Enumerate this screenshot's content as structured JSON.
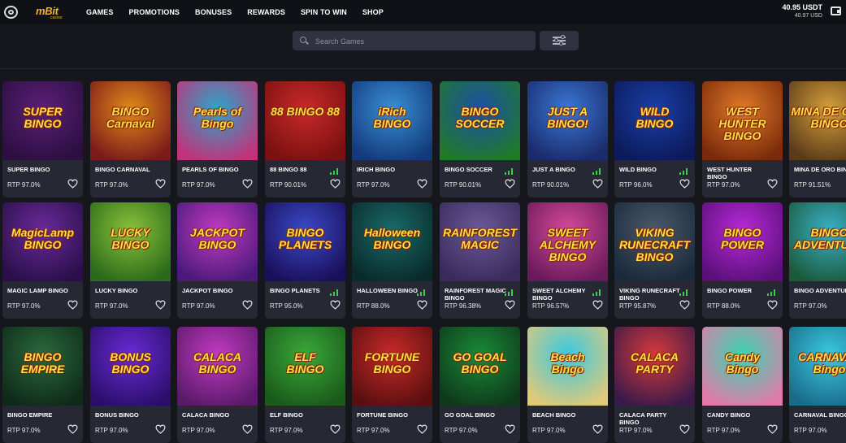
{
  "brand": {
    "name": "mBit",
    "sub": "casino"
  },
  "nav": [
    "GAMES",
    "PROMOTIONS",
    "BONUSES",
    "REWARDS",
    "SPIN TO WIN",
    "SHOP"
  ],
  "balance": {
    "main": "40.95 USDT",
    "sub": "40.97 USD"
  },
  "search": {
    "placeholder": "Search Games"
  },
  "colors": {
    "accent": "#f0b323",
    "bg": "#16171d",
    "card": "#262833",
    "signal": "#3ecf4a"
  },
  "games": [
    {
      "title": "SUPER BINGO",
      "rtp": "RTP 97.0%",
      "art": "SUPER\nBINGO",
      "bg": "#5a1f78,#2c0f40",
      "signal": false
    },
    {
      "title": "BINGO CARNAVAL",
      "rtp": "RTP 97.0%",
      "art": "BINGO\nCarnaval",
      "bg": "#e08a1a,#7a1a1a",
      "signal": false
    },
    {
      "title": "PEARLS OF BINGO",
      "rtp": "RTP 97.0%",
      "art": "Pearls of\nBingo",
      "bg": "#2aa6c9,#c2327a",
      "signal": false
    },
    {
      "title": "88 BINGO 88",
      "rtp": "RTP 90.01%",
      "art": "88 BINGO 88",
      "bg": "#c92a2a,#7a1010",
      "signal": true
    },
    {
      "title": "IRICH BINGO",
      "rtp": "RTP 97.0%",
      "art": "iRich\nBINGO",
      "bg": "#3a8fd6,#123a7a",
      "signal": false
    },
    {
      "title": "BINGO SOCCER",
      "rtp": "RTP 90.01%",
      "art": "BINGO SOCCER",
      "bg": "#1d4fa8,#1f7a2a",
      "signal": true
    },
    {
      "title": "JUST A BINGO",
      "rtp": "RTP 90.01%",
      "art": "JUST A BINGO!",
      "bg": "#3a78d6,#1a2a6a",
      "signal": true
    },
    {
      "title": "WILD BINGO",
      "rtp": "RTP 96.0%",
      "art": "WILD\nBINGO",
      "bg": "#1a3fa8,#0c1a5a",
      "signal": true
    },
    {
      "title": "WEST HUNTER BINGO",
      "rtp": "RTP 97.0%",
      "art": "WEST HUNTER\nBINGO",
      "bg": "#e07a2a,#7a2a0a",
      "signal": false
    },
    {
      "title": "MINA DE ORO BINGO",
      "rtp": "RTP 91.51%",
      "art": "MINA DE ORO\nBINGO",
      "bg": "#d6a03a,#5a3a1a",
      "signal": true
    },
    {
      "title": "MAGIC LAMP BINGO",
      "rtp": "RTP 97.0%",
      "art": "MagicLamp\nBINGO",
      "bg": "#6a2a9a,#2a0f4a",
      "signal": false
    },
    {
      "title": "LUCKY BINGO",
      "rtp": "RTP 97.0%",
      "art": "LUCKY\nBINGO",
      "bg": "#8ac23a,#2a6a1a",
      "signal": false
    },
    {
      "title": "JACKPOT BINGO",
      "rtp": "RTP 97.0%",
      "art": "JACKPOT\nBINGO",
      "bg": "#c23ac2,#4a1a7a",
      "signal": false
    },
    {
      "title": "BINGO PLANETS",
      "rtp": "RTP 95.0%",
      "art": "BINGO\nPLANETS",
      "bg": "#3a4ac9,#1a0f5a",
      "signal": true
    },
    {
      "title": "HALLOWEEN BINGO",
      "rtp": "RTP 88.0%",
      "art": "Halloween\nBINGO",
      "bg": "#1a6a6a,#0a2a2a",
      "signal": true
    },
    {
      "title": "RAINFOREST MAGIC BINGO",
      "rtp": "RTP 96.38%",
      "art": "RAINFOREST\nMAGIC",
      "bg": "#6a5a9a,#3a2a5a",
      "signal": true
    },
    {
      "title": "SWEET ALCHEMY BINGO",
      "rtp": "RTP 96.57%",
      "art": "SWEET\nALCHEMY\nBINGO",
      "bg": "#d64a9a,#6a1a5a",
      "signal": true
    },
    {
      "title": "VIKING RUNECRAFT BINGO",
      "rtp": "RTP 95.87%",
      "art": "VIKING\nRUNECRAFT\nBINGO",
      "bg": "#4a5a6a,#1a2a3a",
      "signal": true
    },
    {
      "title": "BINGO POWER",
      "rtp": "RTP 88.0%",
      "art": "BINGO\nPOWER",
      "bg": "#b82ad6,#5a0f7a",
      "signal": true
    },
    {
      "title": "BINGO ADVENTURE",
      "rtp": "RTP 97.0%",
      "art": "BINGO\nADVENTURE",
      "bg": "#3ab0c9,#1a5a3a",
      "signal": false
    },
    {
      "title": "BINGO EMPIRE",
      "rtp": "RTP 97.0%",
      "art": "BINGO\nEMPIRE",
      "bg": "#2a6a3a,#0f2a1a",
      "signal": false
    },
    {
      "title": "BONUS BINGO",
      "rtp": "RTP 97.0%",
      "art": "BONUS\nBINGO",
      "bg": "#6a2ad6,#2a0f6a",
      "signal": false
    },
    {
      "title": "CALACA BINGO",
      "rtp": "RTP 97.0%",
      "art": "CALACA\nBINGO",
      "bg": "#c23ac2,#5a1a6a",
      "signal": false
    },
    {
      "title": "ELF BINGO",
      "rtp": "RTP 97.0%",
      "art": "ELF\nBINGO",
      "bg": "#3aa83a,#1a5a1a",
      "signal": false
    },
    {
      "title": "FORTUNE BINGO",
      "rtp": "RTP 97.0%",
      "art": "FORTUNE\nBINGO",
      "bg": "#c92a2a,#5a0f0f",
      "signal": false
    },
    {
      "title": "GO GOAL BINGO",
      "rtp": "RTP 97.0%",
      "art": "GO GOAL\nBINGO",
      "bg": "#1a8a3a,#0f3a1a",
      "signal": false
    },
    {
      "title": "BEACH BINGO",
      "rtp": "RTP 97.0%",
      "art": "Beach\nBingo",
      "bg": "#3ac9e0,#e0c97a",
      "signal": false
    },
    {
      "title": "CALACA PARTY BINGO",
      "rtp": "RTP 97.0%",
      "art": "CALACA\nPARTY",
      "bg": "#d63a3a,#3a1a4a",
      "signal": false
    },
    {
      "title": "CANDY BINGO",
      "rtp": "RTP 97.0%",
      "art": "Candy\nBingo",
      "bg": "#3ad6b0,#e07aa8",
      "signal": false
    },
    {
      "title": "CARNAVAL BINGO",
      "rtp": "RTP 97.0%",
      "art": "CARNAVAL\nBingo",
      "bg": "#3ac9e0,#1a6a8a",
      "signal": false
    }
  ]
}
